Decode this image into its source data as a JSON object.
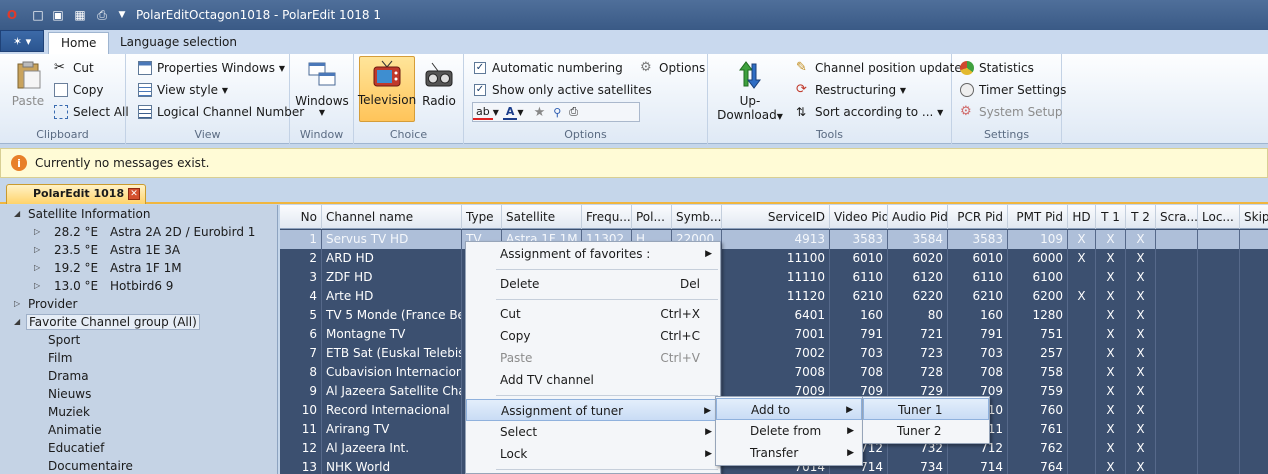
{
  "title_bar": {
    "app_title": "PolarEditOctagon1018 - PolarEdit 1018 1",
    "quick_access_icons": [
      "opera-logo-icon",
      "new-file-icon",
      "open-folder-icon",
      "save-icon",
      "print-icon",
      "dropdown-arrow-icon"
    ]
  },
  "ribbon": {
    "tabs": [
      "Home",
      "Language selection"
    ],
    "active_tab": "Home",
    "groups": {
      "clipboard": {
        "label": "Clipboard",
        "paste": "Paste",
        "cut": "Cut",
        "copy": "Copy",
        "select_all": "Select All"
      },
      "view": {
        "label": "View",
        "properties_windows": "Properties Windows",
        "view_style": "View style",
        "logical_channel_number": "Logical Channel Number"
      },
      "window": {
        "label": "Window",
        "windows": "Windows"
      },
      "choice": {
        "label": "Choice",
        "television": "Television",
        "radio": "Radio"
      },
      "options": {
        "label": "Options",
        "automatic_numbering": "Automatic numbering",
        "automatic_numbering_checked": true,
        "show_only_active_satellites": "Show only active satellites",
        "show_only_active_checked": true,
        "options": "Options"
      },
      "tools": {
        "label": "Tools",
        "up_download_line1": "Up-",
        "up_download_line2": "Download",
        "channel_position_update": "Channel position update",
        "restructuring": "Restructuring",
        "sort_according_to": "Sort according to ..."
      },
      "settings": {
        "label": "Settings",
        "statistics": "Statistics",
        "timer_settings": "Timer Settings",
        "system_setup": "System Setup"
      }
    }
  },
  "message_bar": {
    "text": "Currently no messages exist."
  },
  "document_tab": {
    "label": "PolarEdit 1018 1"
  },
  "tree": {
    "satellite_information": "Satellite Information",
    "satellites": [
      {
        "deg": "28.2 °E",
        "name": "Astra 2A 2D / Eurobird 1"
      },
      {
        "deg": "23.5 °E",
        "name": "Astra 1E 3A"
      },
      {
        "deg": "19.2 °E",
        "name": "Astra 1F 1M"
      },
      {
        "deg": "13.0 °E",
        "name": "Hotbird6 9"
      }
    ],
    "provider": "Provider",
    "favorite_group": "Favorite Channel group (All)",
    "favorites": [
      "Sport",
      "Film",
      "Drama",
      "Nieuws",
      "Muziek",
      "Animatie",
      "Educatief",
      "Documentaire"
    ]
  },
  "grid": {
    "columns": [
      "No",
      "Channel name",
      "Type",
      "Satellite",
      "Frequ...",
      "Pol...",
      "Symb...",
      "ServiceID",
      "Video Pid",
      "Audio Pid",
      "PCR Pid",
      "PMT Pid",
      "HD",
      "T 1",
      "T 2",
      "Scra...",
      "Loc...",
      "Skip"
    ],
    "selected_row": {
      "no": "1",
      "name": "Servus TV HD",
      "type": "TV",
      "satellite": "Astra 1F 1M",
      "freq": "11302",
      "pol": "H",
      "symb": "22000",
      "sid": "4913",
      "vpid": "3583",
      "apid": "3584",
      "pcr": "3583",
      "pmt": "109",
      "hd": "X",
      "t1": "X",
      "t2": "X"
    },
    "rows": [
      {
        "no": "2",
        "name": "ARD HD",
        "sid": "11100",
        "vpid": "6010",
        "apid": "6020",
        "pcr": "6010",
        "pmt": "6000",
        "hd": "X",
        "t1": "X",
        "t2": "X"
      },
      {
        "no": "3",
        "name": "ZDF HD",
        "sid": "11110",
        "vpid": "6110",
        "apid": "6120",
        "pcr": "6110",
        "pmt": "6100",
        "hd": "",
        "t1": "X",
        "t2": "X"
      },
      {
        "no": "4",
        "name": "Arte HD",
        "sid": "11120",
        "vpid": "6210",
        "apid": "6220",
        "pcr": "6210",
        "pmt": "6200",
        "hd": "X",
        "t1": "X",
        "t2": "X"
      },
      {
        "no": "5",
        "name": "TV 5 Monde (France Bel...",
        "sid": "6401",
        "vpid": "160",
        "apid": "80",
        "pcr": "160",
        "pmt": "1280",
        "hd": "",
        "t1": "X",
        "t2": "X"
      },
      {
        "no": "6",
        "name": "Montagne TV",
        "sid": "7001",
        "vpid": "791",
        "apid": "721",
        "pcr": "791",
        "pmt": "751",
        "hd": "",
        "t1": "X",
        "t2": "X"
      },
      {
        "no": "7",
        "name": "ETB Sat (Euskal Telebista)",
        "sid": "7002",
        "vpid": "703",
        "apid": "723",
        "pcr": "703",
        "pmt": "257",
        "hd": "",
        "t1": "X",
        "t2": "X"
      },
      {
        "no": "8",
        "name": "Cubavision Internacional",
        "sid": "7008",
        "vpid": "708",
        "apid": "728",
        "pcr": "708",
        "pmt": "758",
        "hd": "",
        "t1": "X",
        "t2": "X"
      },
      {
        "no": "9",
        "name": "Al Jazeera Satellite Cha...",
        "sid": "7009",
        "vpid": "709",
        "apid": "729",
        "pcr": "709",
        "pmt": "759",
        "hd": "",
        "t1": "X",
        "t2": "X"
      },
      {
        "no": "10",
        "name": "Record Internacional",
        "sid": "",
        "vpid": "",
        "apid": "",
        "pcr": "710",
        "pmt": "760",
        "hd": "",
        "t1": "X",
        "t2": "X"
      },
      {
        "no": "11",
        "name": "Arirang TV",
        "sid": "",
        "vpid": "",
        "apid": "",
        "pcr": "711",
        "pmt": "761",
        "hd": "",
        "t1": "X",
        "t2": "X"
      },
      {
        "no": "12",
        "name": "Al Jazeera Int.",
        "sid": "",
        "vpid": "712",
        "apid": "732",
        "pcr": "712",
        "pmt": "762",
        "hd": "",
        "t1": "X",
        "t2": "X"
      },
      {
        "no": "13",
        "name": "NHK World",
        "sid": "7014",
        "vpid": "714",
        "apid": "734",
        "pcr": "714",
        "pmt": "764",
        "hd": "",
        "t1": "X",
        "t2": "X"
      }
    ]
  },
  "context_menu": {
    "assignment_of_favorites": "Assignment of favorites :",
    "delete": "Delete",
    "delete_shortcut": "Del",
    "cut": "Cut",
    "cut_shortcut": "Ctrl+X",
    "copy": "Copy",
    "copy_shortcut": "Ctrl+C",
    "paste": "Paste",
    "paste_shortcut": "Ctrl+V",
    "add_tv_channel": "Add TV channel",
    "assignment_of_tuner": "Assignment of tuner",
    "select": "Select",
    "lock": "Lock"
  },
  "submenu_tuner": {
    "add_to": "Add to",
    "delete_from": "Delete from",
    "transfer": "Transfer"
  },
  "submenu_add_to": {
    "tuner1": "Tuner 1",
    "tuner2": "Tuner 2"
  }
}
